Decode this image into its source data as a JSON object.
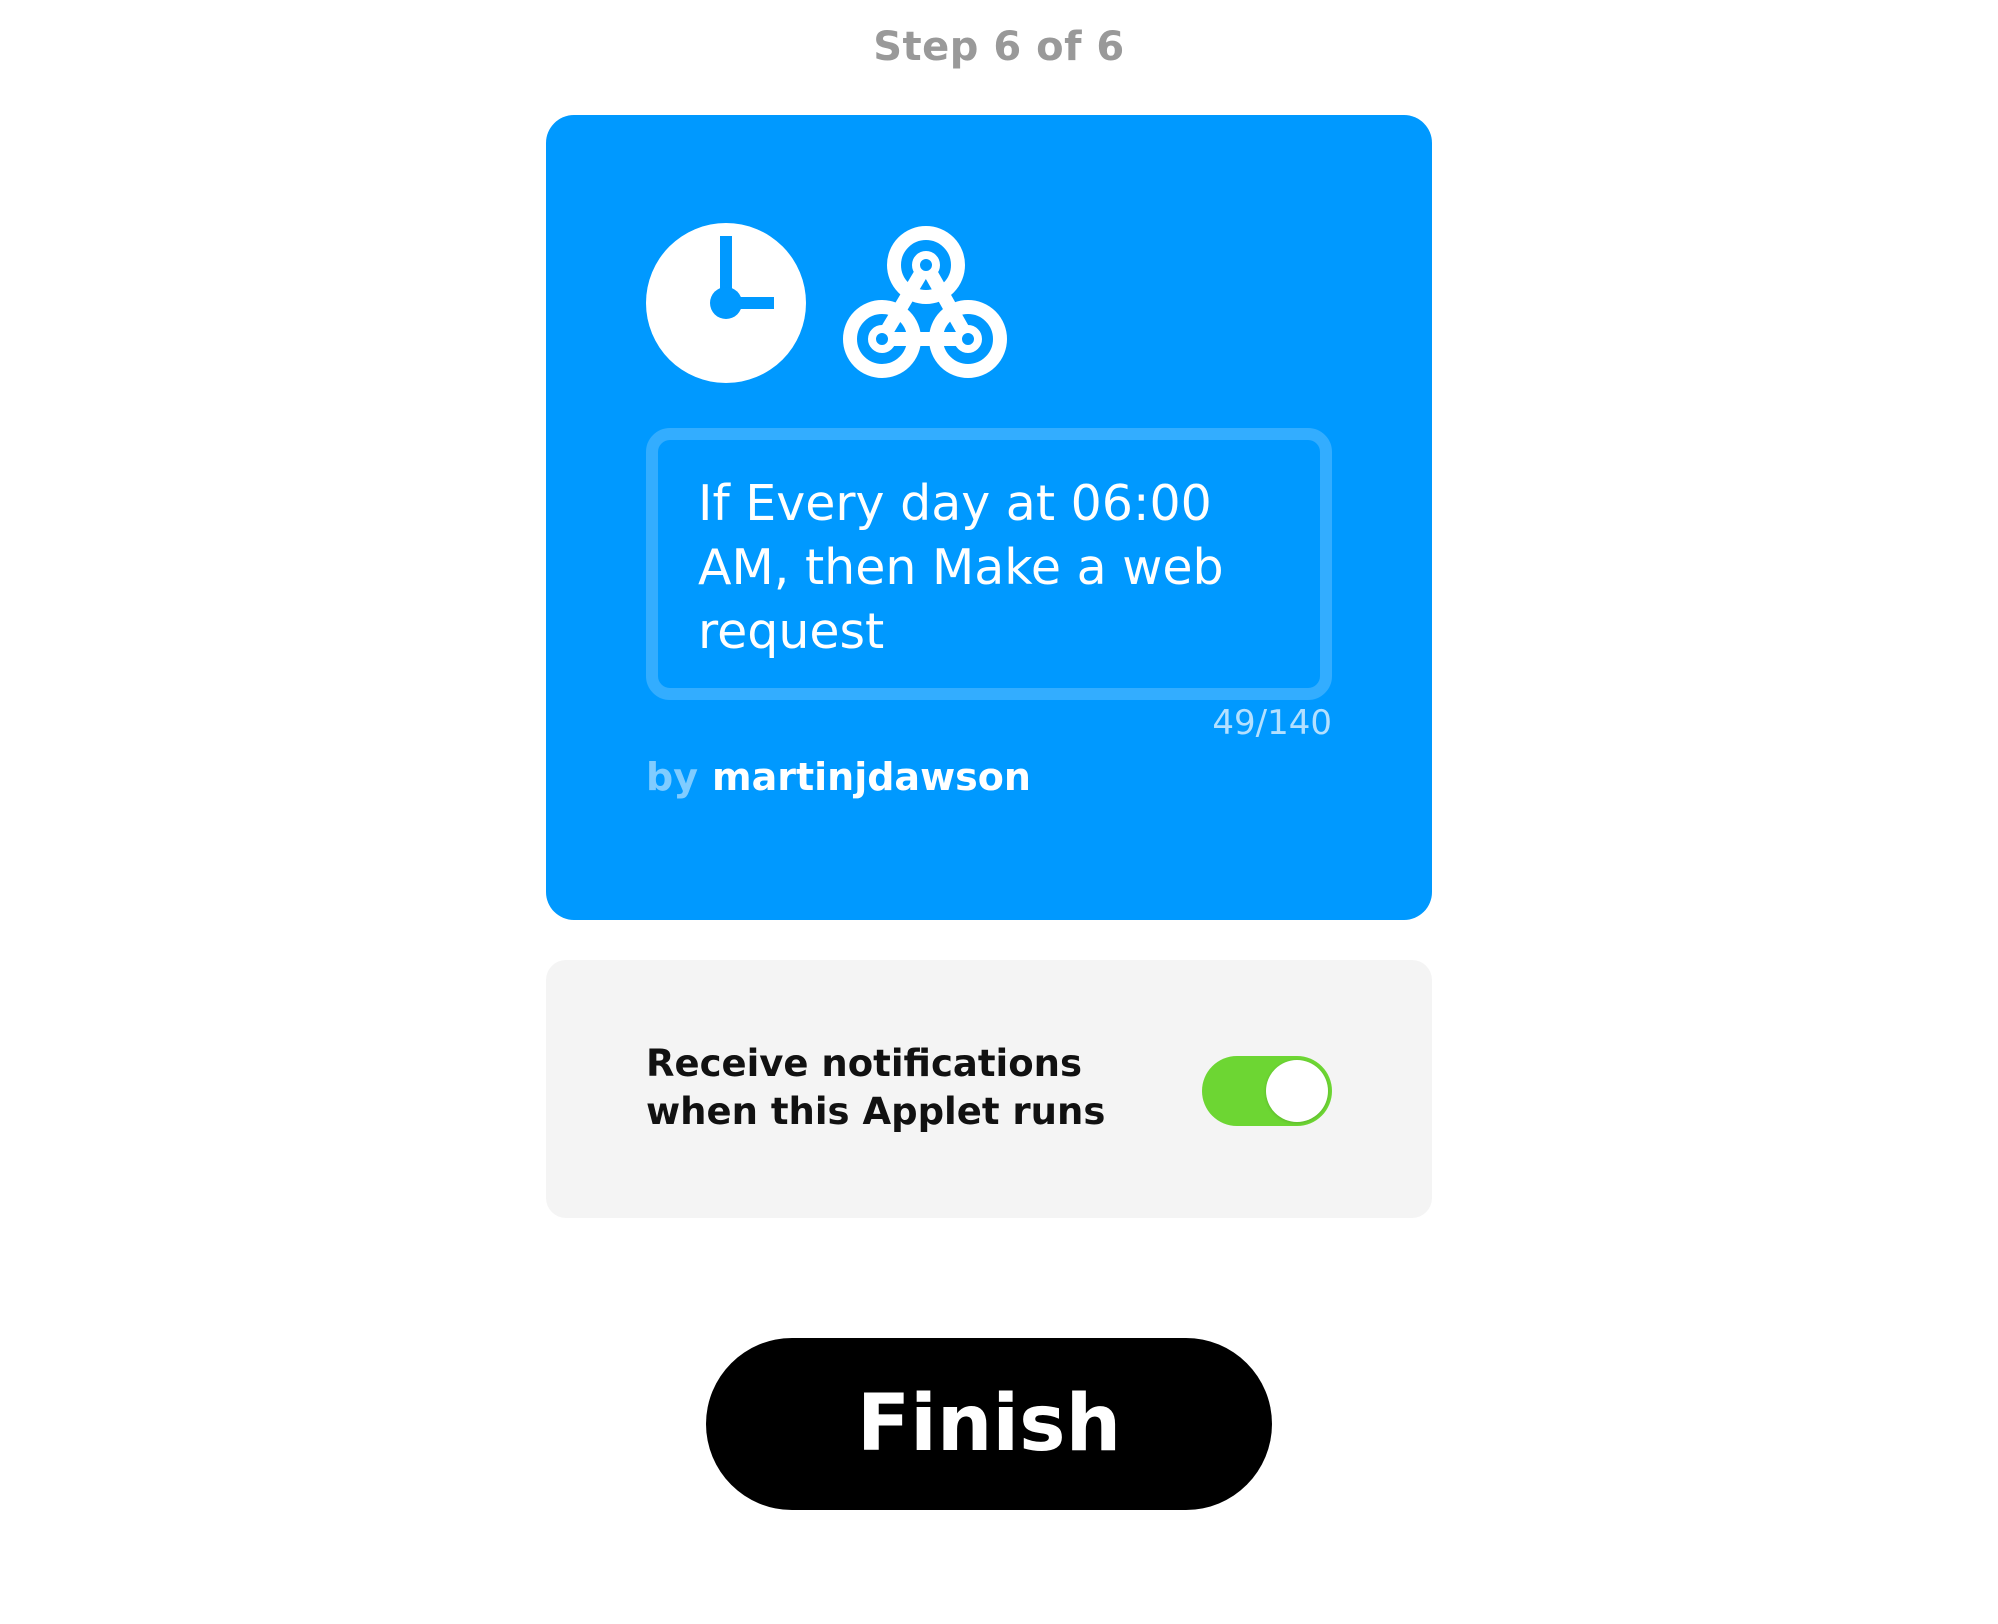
{
  "header": {
    "step_label": "Step 6 of 6"
  },
  "applet": {
    "background_color": "#0099ff",
    "trigger_service_icon": "clock-icon",
    "action_service_icon": "webhooks-icon",
    "title": "If Every day at 06:00 AM, then Make a web request",
    "char_count": "49/140",
    "author_prefix": "by",
    "author_name": "martinjdawson"
  },
  "notifications": {
    "label": "Receive notifications when this Applet runs",
    "enabled": true,
    "toggle_color": "#6dd633"
  },
  "actions": {
    "finish_label": "Finish"
  }
}
